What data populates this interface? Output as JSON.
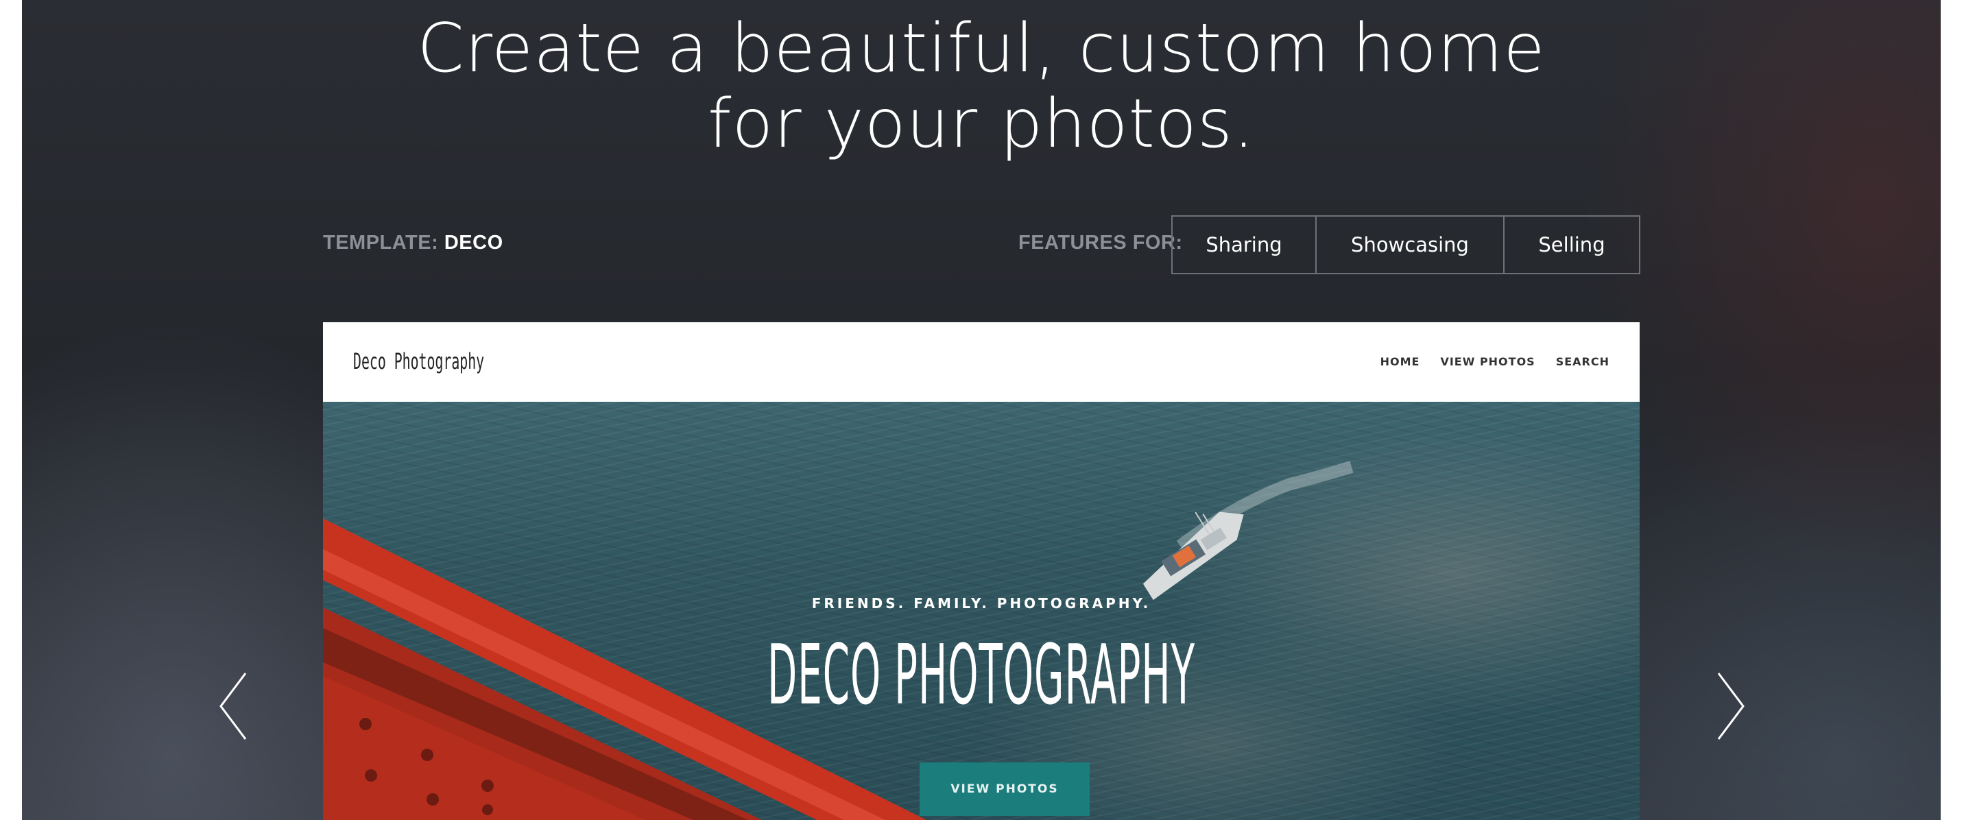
{
  "headline": {
    "line1": "Create a beautiful, custom home",
    "line2": "for your photos."
  },
  "template": {
    "label": "TEMPLATE:",
    "name": "DECO"
  },
  "features": {
    "label": "FEATURES FOR:",
    "tabs": [
      "Sharing",
      "Showcasing",
      "Selling"
    ]
  },
  "preview": {
    "logo": "Deco Photography",
    "menu": [
      "HOME",
      "VIEW PHOTOS",
      "SEARCH"
    ],
    "tagline": "FRIENDS. FAMILY. PHOTOGRAPHY.",
    "title": "DECO PHOTOGRAPHY",
    "button": "VIEW PHOTOS"
  },
  "colors": {
    "background": "#2a2d33",
    "accent_button": "#1b7d7c",
    "bridge_red": "#c8331f",
    "water": "#31565f"
  },
  "icons": {
    "prev": "chevron-left-icon",
    "next": "chevron-right-icon"
  }
}
